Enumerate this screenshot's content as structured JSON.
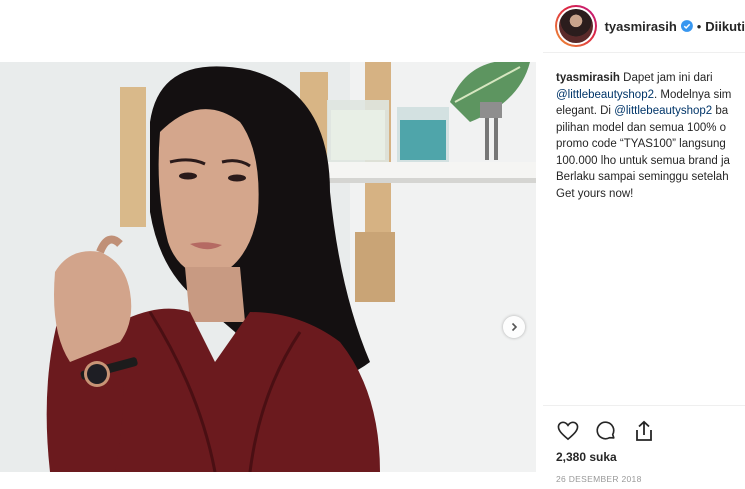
{
  "header": {
    "username": "tyasmirasih",
    "separator": "•",
    "follow_status": "Diikuti"
  },
  "caption": {
    "username": "tyasmirasih",
    "lines": [
      {
        "pre": " Dapet jam ini dari",
        "mention": "",
        "post": ""
      },
      {
        "pre": "",
        "mention": "@littlebeautyshop2",
        "post": ". Modelnya sim"
      },
      {
        "pre": "elegant. Di ",
        "mention": "@littlebeautyshop2",
        "post": " ba"
      },
      {
        "pre": "pilihan model dan semua 100% o",
        "mention": "",
        "post": ""
      },
      {
        "pre": "promo code “TYAS100” langsung",
        "mention": "",
        "post": ""
      },
      {
        "pre": "100.000 lho untuk semua brand ja",
        "mention": "",
        "post": ""
      },
      {
        "pre": "Berlaku sampai seminggu setelah",
        "mention": "",
        "post": ""
      },
      {
        "pre": "Get yours now!",
        "mention": "",
        "post": ""
      }
    ]
  },
  "stats": {
    "likes": "2,380 suka",
    "date": "26 DESEMBER 2018"
  },
  "colors": {
    "verified": "#3897f0",
    "mention": "#003569",
    "robe": "#6b1a1e"
  }
}
